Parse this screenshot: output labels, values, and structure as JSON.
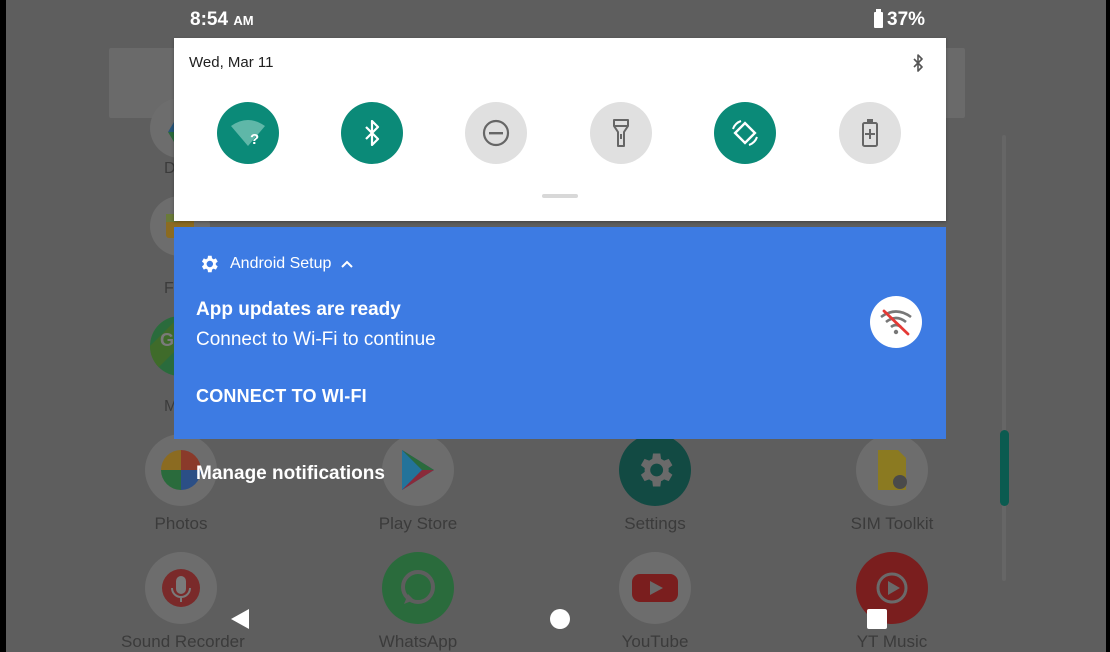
{
  "status_bar": {
    "time": "8:54",
    "ampm": "AM",
    "battery": "37%"
  },
  "quick_settings": {
    "date": "Wed, Mar 11",
    "tiles": [
      {
        "id": "wifi",
        "icon": "wifi-question-icon",
        "active": true
      },
      {
        "id": "bluetooth",
        "icon": "bluetooth-icon",
        "active": true
      },
      {
        "id": "dnd",
        "icon": "do-not-disturb-icon",
        "active": false
      },
      {
        "id": "flashlight",
        "icon": "flashlight-icon",
        "active": false
      },
      {
        "id": "auto-rotate",
        "icon": "auto-rotate-icon",
        "active": true
      },
      {
        "id": "battery-saver",
        "icon": "battery-saver-icon",
        "active": false
      }
    ]
  },
  "notification": {
    "app_name": "Android Setup",
    "title": "App updates are ready",
    "text": "Connect to Wi-Fi to continue",
    "action": "CONNECT TO WI-FI",
    "icon": "wifi-off-icon"
  },
  "manage_notifications": "Manage notifications",
  "home_apps": [
    {
      "label": "Photos",
      "icon": "photos-icon"
    },
    {
      "label": "Play Store",
      "icon": "play-store-icon"
    },
    {
      "label": "Settings",
      "icon": "settings-icon"
    },
    {
      "label": "SIM Toolkit",
      "icon": "sim-toolkit-icon"
    },
    {
      "label": "Sound Recorder",
      "icon": "sound-recorder-icon"
    },
    {
      "label": "WhatsApp",
      "icon": "whatsapp-icon"
    },
    {
      "label": "YouTube",
      "icon": "youtube-icon"
    },
    {
      "label": "YT Music",
      "icon": "yt-music-icon"
    }
  ],
  "home_side_labels": [
    "D",
    "F",
    "M"
  ],
  "colors": {
    "accent_teal": "#0b8a78",
    "notification_blue": "#3d7be3",
    "dimmed_background": "#5e5e5e"
  }
}
